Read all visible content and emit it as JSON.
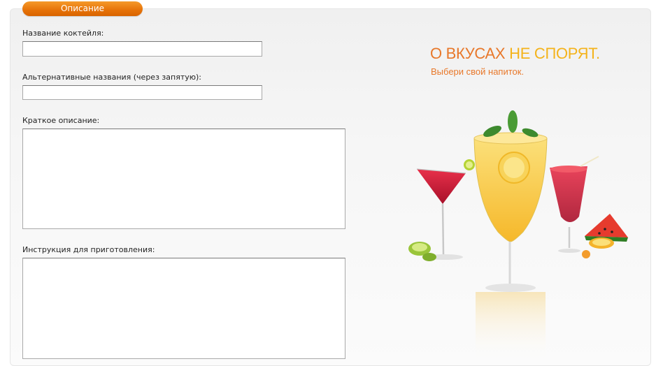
{
  "tab": {
    "label": "Описание"
  },
  "form": {
    "name_label": "Название коктейля:",
    "name_value": "",
    "alt_label": "Альтернативные названия (через запятую):",
    "alt_value": "",
    "short_label": "Краткое описание:",
    "short_value": "",
    "instr_label": "Инструкция для приготовления:",
    "instr_value": ""
  },
  "promo": {
    "headline_part1": "О ВКУСАХ",
    "headline_part2": "НЕ СПОРЯТ.",
    "subline": "Выбери свой напиток."
  },
  "colors": {
    "accent": "#e8782a",
    "accent_yellow": "#f4b31b",
    "tab": "#e67208"
  }
}
